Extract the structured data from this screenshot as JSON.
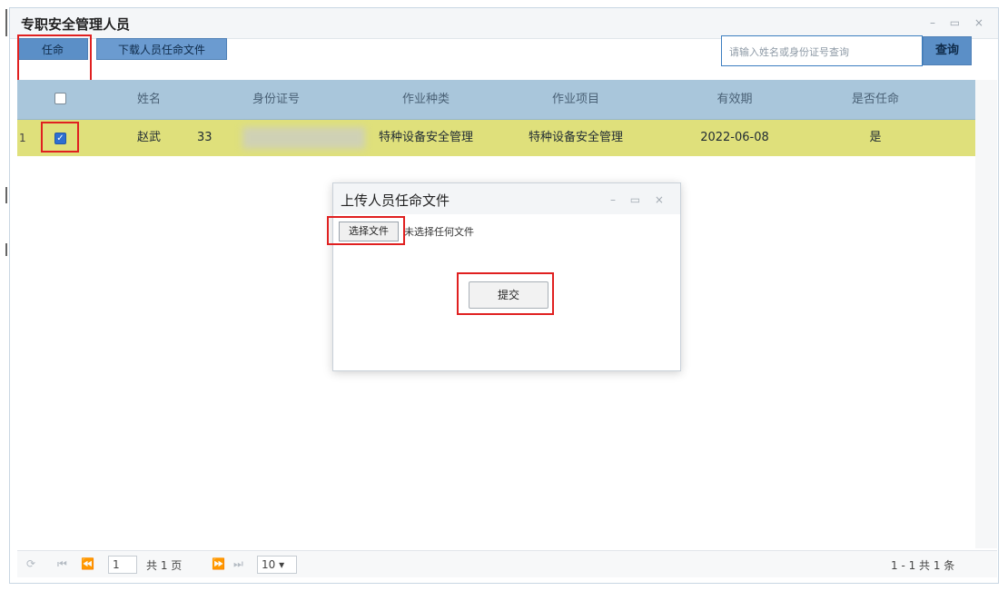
{
  "window": {
    "title": "专职安全管理人员",
    "controls": "– ▭ ×"
  },
  "toolbar": {
    "appoint_label": "任命",
    "download_label": "下载人员任命文件"
  },
  "search": {
    "placeholder": "请输入姓名或身份证号查询",
    "query_label": "查询"
  },
  "table": {
    "columns": [
      "姓名",
      "身份证号",
      "作业种类",
      "作业项目",
      "有效期",
      "是否任命"
    ],
    "rows": [
      {
        "num": "1",
        "checked": true,
        "name": "赵武",
        "id_prefix": "33",
        "work_type": "特种设备安全管理",
        "work_item": "特种设备安全管理",
        "valid": "2022-06-08",
        "appointed": "是"
      }
    ]
  },
  "pager": {
    "refresh_icon": "⟳",
    "first": "⏮",
    "prev": "⏪",
    "page": "1",
    "total_pages": "共 1 页",
    "next": "⏩",
    "last": "⏭",
    "page_size": "10",
    "summary": "1 - 1  共 1 条"
  },
  "dialog": {
    "title": "上传人员任命文件",
    "controls": "– ▭ ×",
    "choose_file_label": "选择文件",
    "file_status": "未选择任何文件",
    "submit_label": "提交"
  },
  "colors": {
    "accent_blue": "#5b8fc7",
    "header_blue": "#a9c6db",
    "row_highlight": "#dfe07b",
    "annotation_red": "#e02020"
  }
}
